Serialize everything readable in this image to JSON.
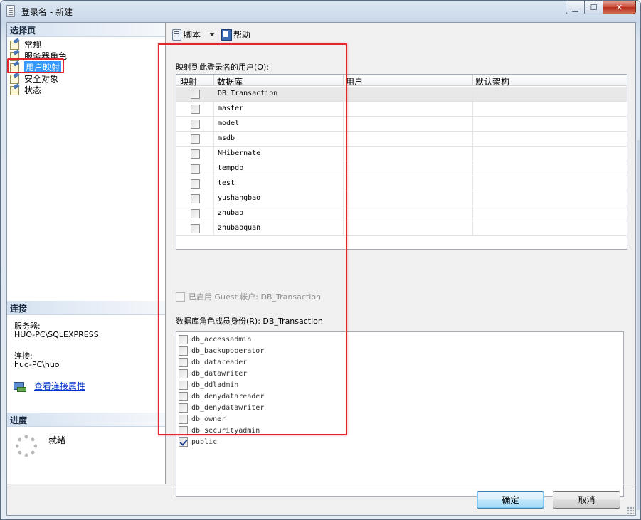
{
  "window": {
    "title": "登录名 - 新建"
  },
  "caption_buttons": {
    "minimize": "▁",
    "maximize": "☐",
    "close": "✕"
  },
  "left_panel": {
    "select_page_header": "选择页",
    "nav_items": [
      {
        "label": "常规",
        "icon": "page-icon"
      },
      {
        "label": "服务器角色",
        "icon": "page-icon"
      },
      {
        "label": "用户映射",
        "icon": "page-icon",
        "selected": true
      },
      {
        "label": "安全对象",
        "icon": "page-icon"
      },
      {
        "label": "状态",
        "icon": "page-icon"
      }
    ],
    "connection_header": "连接",
    "server_label": "服务器:",
    "server_value": "HUO-PC\\SQLEXPRESS",
    "connection_label": "连接:",
    "connection_value": "huo-PC\\huo",
    "view_connection_link": "查看连接属性",
    "progress_header": "进度",
    "progress_status": "就绪"
  },
  "toolbar": {
    "script_label": "脚本",
    "help_label": "帮助"
  },
  "user_mapping": {
    "section_label": "映射到此登录名的用户(O):",
    "columns": [
      "映射",
      "数据库",
      "用户",
      "默认架构"
    ],
    "rows": [
      {
        "mapped": false,
        "database": "DB_Transaction",
        "user": "",
        "default_schema": ""
      },
      {
        "mapped": false,
        "database": "master",
        "user": "",
        "default_schema": ""
      },
      {
        "mapped": false,
        "database": "model",
        "user": "",
        "default_schema": ""
      },
      {
        "mapped": false,
        "database": "msdb",
        "user": "",
        "default_schema": ""
      },
      {
        "mapped": false,
        "database": "NHibernate",
        "user": "",
        "default_schema": ""
      },
      {
        "mapped": false,
        "database": "tempdb",
        "user": "",
        "default_schema": ""
      },
      {
        "mapped": false,
        "database": "test",
        "user": "",
        "default_schema": ""
      },
      {
        "mapped": false,
        "database": "yushangbao",
        "user": "",
        "default_schema": ""
      },
      {
        "mapped": false,
        "database": "zhubao",
        "user": "",
        "default_schema": ""
      },
      {
        "mapped": false,
        "database": "zhubaoquan",
        "user": "",
        "default_schema": ""
      }
    ]
  },
  "guest": {
    "label": "已启用 Guest 帐户: DB_Transaction",
    "checked": false,
    "enabled": false
  },
  "roles": {
    "section_label": "数据库角色成员身份(R): DB_Transaction",
    "items": [
      {
        "name": "db_accessadmin",
        "checked": false
      },
      {
        "name": "db_backupoperator",
        "checked": false
      },
      {
        "name": "db_datareader",
        "checked": false
      },
      {
        "name": "db_datawriter",
        "checked": false
      },
      {
        "name": "db_ddladmin",
        "checked": false
      },
      {
        "name": "db_denydatareader",
        "checked": false
      },
      {
        "name": "db_denydatawriter",
        "checked": false
      },
      {
        "name": "db_owner",
        "checked": false
      },
      {
        "name": "db_securityadmin",
        "checked": false
      },
      {
        "name": "public",
        "checked": true
      }
    ]
  },
  "footer": {
    "ok_label": "确定",
    "cancel_label": "取消"
  },
  "colors": {
    "highlight_red": "#e3262b",
    "selection_blue": "#3399ff",
    "link_blue": "#0033cc"
  }
}
